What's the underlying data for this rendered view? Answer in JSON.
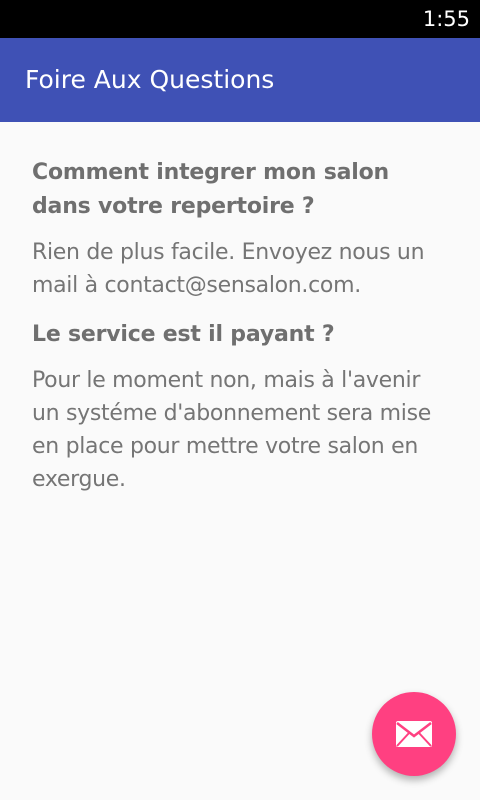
{
  "status_bar": {
    "time": "1:55"
  },
  "app_bar": {
    "title": "Foire Aux Questions"
  },
  "faq": [
    {
      "question": "Comment integrer mon salon dans votre repertoire ?",
      "answer": "Rien de plus facile. Envoyez nous un mail à contact@sensalon.com."
    },
    {
      "question": "Le service est il payant ?",
      "answer": "Pour le moment non, mais à l'avenir un systéme d'abonnement sera mise en place pour mettre votre salon en exergue."
    }
  ],
  "fab": {
    "icon": "mail-icon"
  },
  "colors": {
    "primary": "#3f51b5",
    "accent": "#ff4081",
    "background": "#fafafa"
  }
}
